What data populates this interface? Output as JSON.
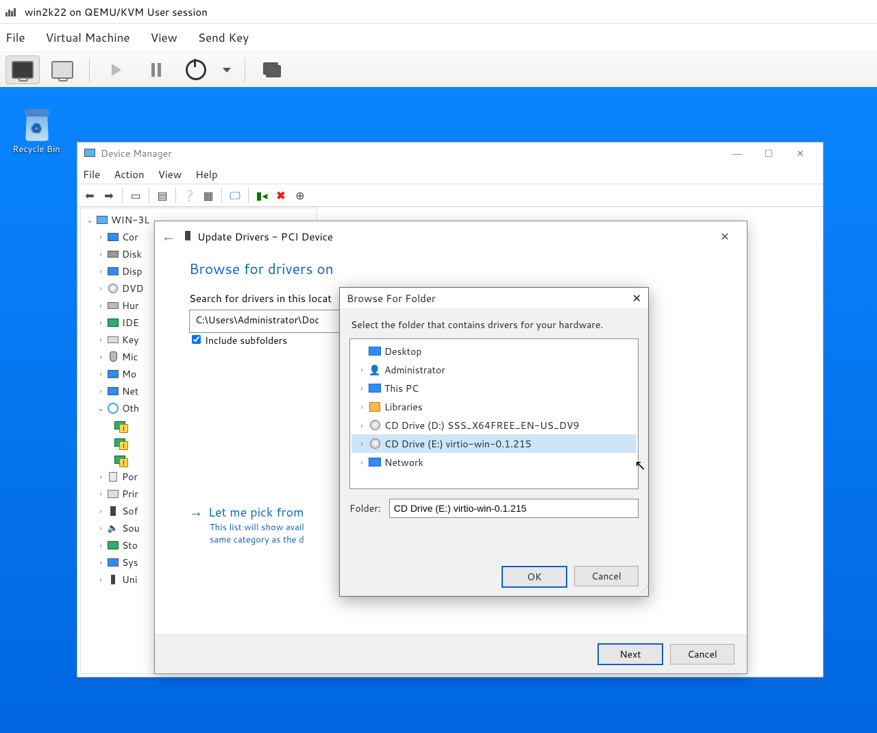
{
  "vmm": {
    "title": "win2k22 on QEMU/KVM User session",
    "menu": [
      "File",
      "Virtual Machine",
      "View",
      "Send Key"
    ]
  },
  "recycle_label": "Recycle Bin",
  "devmgr": {
    "title": "Device Manager",
    "menu": [
      "File",
      "Action",
      "View",
      "Help"
    ],
    "root": "WIN-3L",
    "nodes": [
      {
        "icon": "ic-monitor",
        "label": "Cor"
      },
      {
        "icon": "ic-disk",
        "label": "Disk"
      },
      {
        "icon": "ic-monitor",
        "label": "Disp"
      },
      {
        "icon": "ic-dvd",
        "label": "DVD"
      },
      {
        "icon": "ic-hid",
        "label": "Hur"
      },
      {
        "icon": "ic-ide",
        "label": "IDE"
      },
      {
        "icon": "ic-kbd",
        "label": "Key"
      },
      {
        "icon": "ic-mouse",
        "label": "Mic"
      },
      {
        "icon": "ic-monitor",
        "label": "Mo"
      },
      {
        "icon": "ic-net",
        "label": "Net"
      }
    ],
    "other": "Oth",
    "tail": [
      {
        "icon": "ic-port",
        "label": "Por"
      },
      {
        "icon": "ic-printq",
        "label": "Prir"
      },
      {
        "icon": "ic-sw",
        "label": "Sof"
      },
      {
        "icon": "ic-sound",
        "label": "Sou"
      },
      {
        "icon": "ic-stor",
        "label": "Sto"
      },
      {
        "icon": "ic-sys",
        "label": "Sys"
      },
      {
        "icon": "ic-usb",
        "label": "Uni"
      }
    ]
  },
  "wizard": {
    "title": "Update Drivers - PCI Device",
    "heading": "Browse for drivers on",
    "search_label": "Search for drivers in this locat",
    "path": "C:\\Users\\Administrator\\Doc",
    "include_sub": "Include subfolders",
    "letme_title": "Let me pick from",
    "letme_sub1": "This list will show avail",
    "letme_sub2": "same category as the d",
    "next": "Next",
    "cancel": "Cancel"
  },
  "bff": {
    "title": "Browse For Folder",
    "instr": "Select the folder that contains drivers for your hardware.",
    "items": [
      {
        "icon": "ic-desktop",
        "label": "Desktop",
        "exp": ""
      },
      {
        "icon": "ic-user",
        "label": "Administrator",
        "exp": "›"
      },
      {
        "icon": "ic-pc",
        "label": "This PC",
        "exp": "›"
      },
      {
        "icon": "ic-lib",
        "label": "Libraries",
        "exp": "›"
      },
      {
        "icon": "ic-cd",
        "label": "CD Drive (D:) SSS_X64FREE_EN-US_DV9",
        "exp": "›"
      },
      {
        "icon": "ic-cd",
        "label": "CD Drive (E:) virtio-win-0.1.215",
        "exp": "›",
        "sel": true
      },
      {
        "icon": "ic-netw",
        "label": "Network",
        "exp": "›"
      }
    ],
    "folder_label": "Folder:",
    "folder_value": "CD Drive (E:) virtio-win-0.1.215",
    "ok": "OK",
    "cancel": "Cancel"
  }
}
